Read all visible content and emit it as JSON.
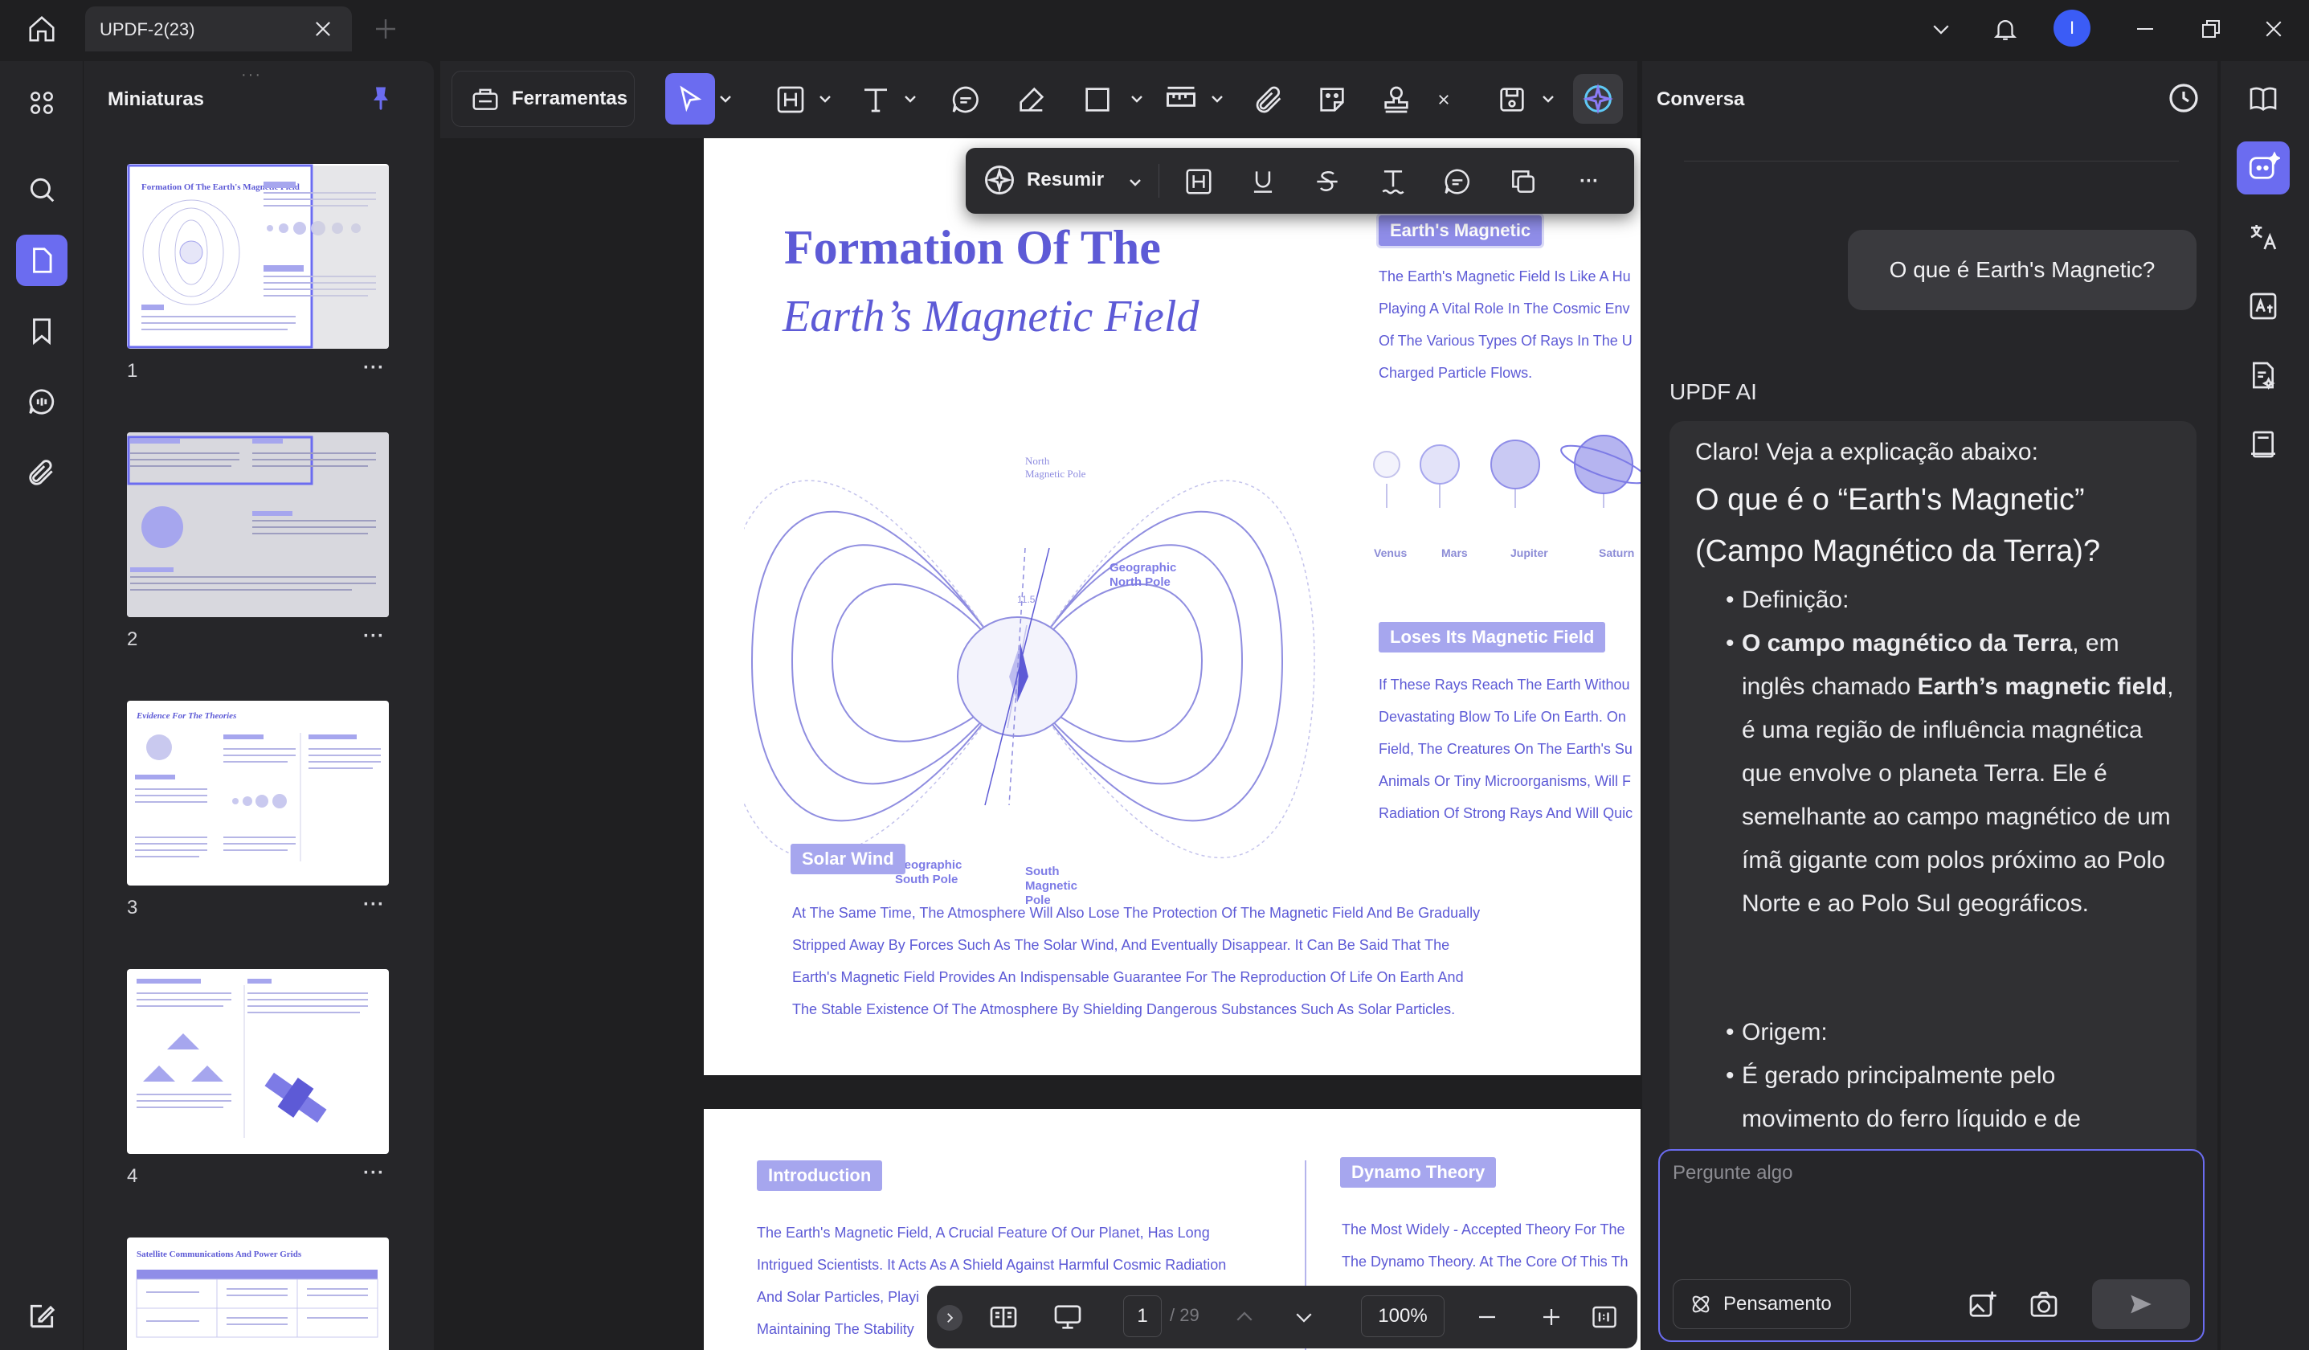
{
  "tab": {
    "title": "UPDF-2(23)"
  },
  "user": {
    "avatar_letter": "I"
  },
  "thumbnails": {
    "title": "Miniaturas",
    "pages": [
      {
        "num": "1",
        "title": "Formation Of The Earth's Magnetic Field"
      },
      {
        "num": "2",
        "title": ""
      },
      {
        "num": "3",
        "title": "Evidence For The Theories"
      },
      {
        "num": "4",
        "title": ""
      },
      {
        "num": "",
        "title": "Satellite Communications And Power Grids"
      }
    ],
    "more": "···"
  },
  "toolbar": {
    "tools_label": "Ferramentas"
  },
  "float_bar": {
    "summary_label": "Resumir",
    "more": "···"
  },
  "page1": {
    "title_line1": "Formation Of The",
    "title_line2": "Earth’s Magnetic Field",
    "diagram": {
      "north_magnetic": [
        "North",
        "Magnetic Pole"
      ],
      "geo_north": [
        "Geographic",
        "North Pole"
      ],
      "geo_south": [
        "Geographic",
        "South Pole"
      ],
      "south_magnetic": [
        "South",
        "Magnetic",
        "Pole"
      ],
      "angle": "11.5"
    },
    "tag_earth": "Earth's Magnetic",
    "earth_text": [
      "The Earth's Magnetic Field Is Like A Hu",
      "Playing A Vital Role In The Cosmic Env",
      "Of The Various Types Of Rays In The U",
      "Charged Particle Flows."
    ],
    "planets": [
      "Venus",
      "Mars",
      "Jupiter",
      "Saturn"
    ],
    "tag_loses": "Loses Its Magnetic Field",
    "loses_text": [
      "If These Rays Reach The Earth Withou",
      "Devastating Blow To Life On Earth. On",
      "Field, The Creatures On The Earth's Su",
      "Animals Or Tiny Microorganisms, Will F",
      "Radiation Of Strong Rays And Will Quic"
    ],
    "tag_solar": "Solar Wind",
    "solar_text": [
      "At The Same Time, The Atmosphere Will Also Lose The Protection Of The Magnetic Field And Be Gradually",
      "Stripped Away By Forces Such As The Solar Wind, And Eventually Disappear. It Can Be Said That The",
      "Earth's Magnetic Field Provides An Indispensable Guarantee For The Reproduction Of Life On Earth And",
      "The Stable Existence Of The Atmosphere By Shielding Dangerous Substances Such As Solar Particles."
    ]
  },
  "page2": {
    "tag_intro": "Introduction",
    "intro_text": [
      "The Earth's Magnetic Field, A Crucial Feature Of Our Planet, Has Long",
      "Intrigued Scientists. It Acts As A Shield Against Harmful Cosmic Radiation",
      "And Solar Particles, Playi",
      "Maintaining The Stability"
    ],
    "tag_dynamo": "Dynamo Theory",
    "dynamo_text": [
      "The Most Widely - Accepted Theory For The",
      "The Dynamo Theory. At The Core Of This Th"
    ]
  },
  "nav": {
    "page": "1",
    "total": "/ 29",
    "zoom": "100%"
  },
  "chat": {
    "title": "Conversa",
    "user_message": "O que é Earth's Magnetic?",
    "ai_name": "UPDF AI",
    "ai_intro": "Claro! Veja a explicação abaixo:",
    "ai_heading": "O que é o “Earth's Magnetic” (Campo Magnético da Terra)?",
    "definition_label": "Definição:",
    "def_part1": "O campo magnético da Terra",
    "def_part2": ", em inglês chamado ",
    "def_part3": "Earth’s magnetic field",
    "def_part4": ", é uma região de influência magnética que envolve o planeta Terra. Ele é semelhante ao campo magnético de um ímã gigante com polos próximo ao Polo Norte e ao Polo Sul geográficos.",
    "origin_label": "Origem:",
    "origin_text": "É gerado principalmente pelo movimento do ferro líquido e de",
    "input_placeholder": "Pergunte algo",
    "think_label": "Pensamento"
  },
  "colors": {
    "accent": "#6b6cf0",
    "doc_purple": "#5d5ad6",
    "tag_bg": "#a6a6ee",
    "panel": "#262629"
  }
}
